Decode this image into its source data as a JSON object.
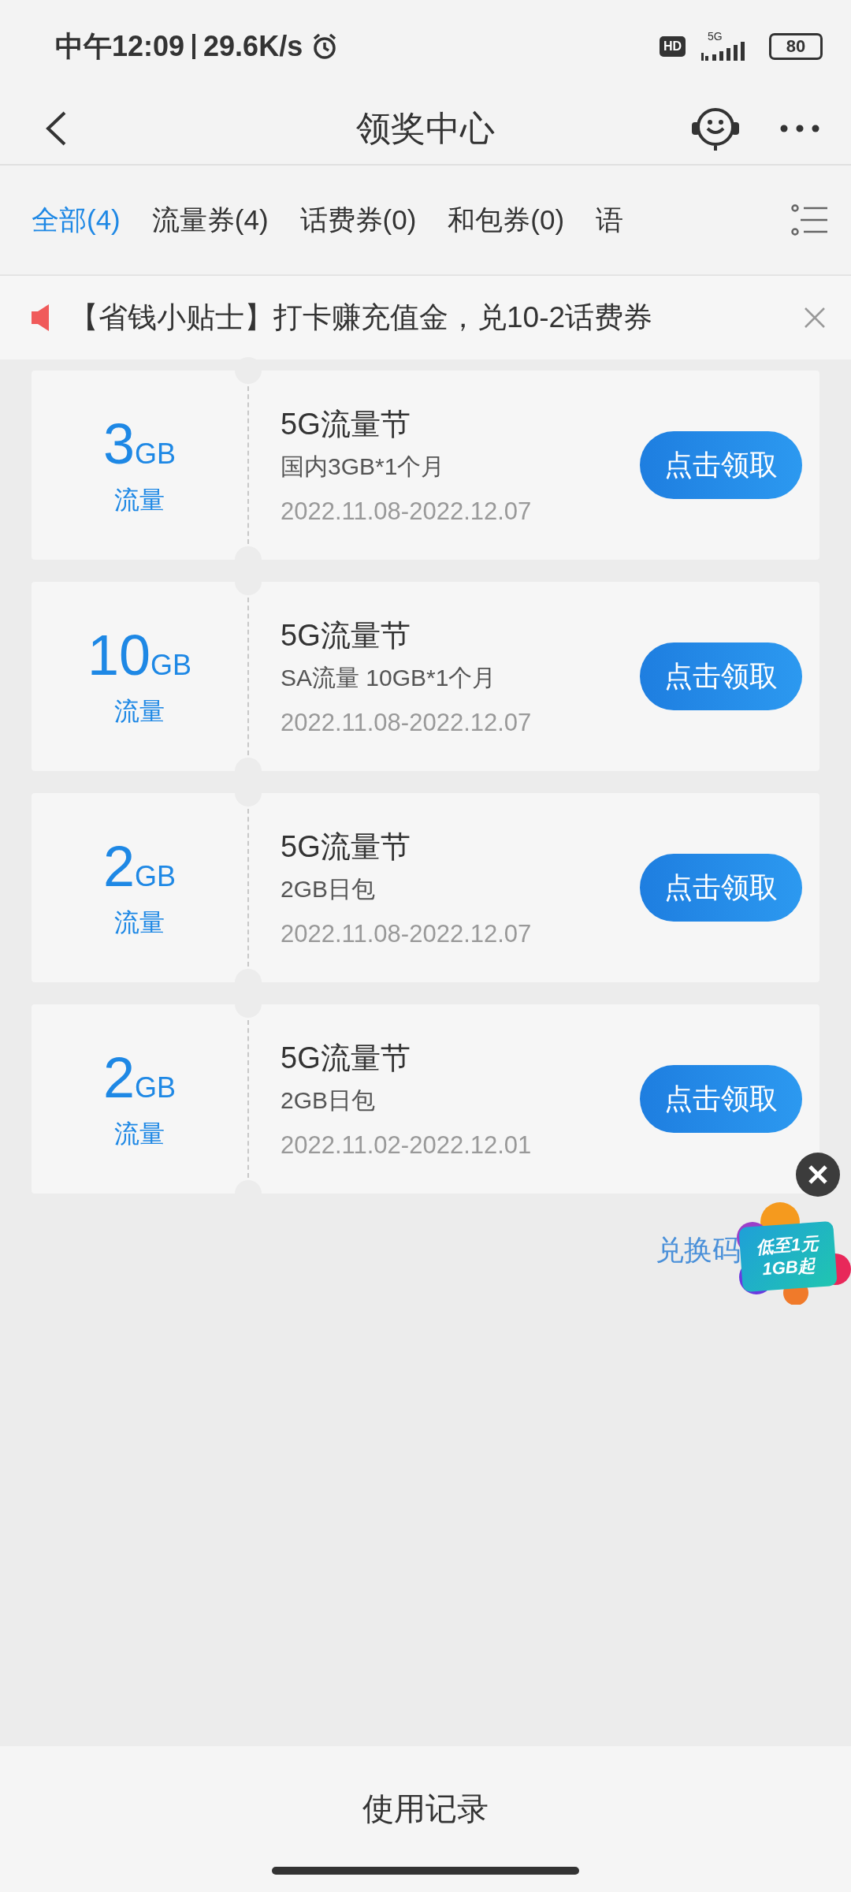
{
  "status_bar": {
    "time": "中午12:09",
    "speed": "29.6K/s",
    "hd": "HD",
    "network": "5G",
    "battery": "80"
  },
  "header": {
    "title": "领奖中心"
  },
  "tabs": [
    {
      "label": "全部(4)",
      "selected": true
    },
    {
      "label": "流量券(4)",
      "selected": false
    },
    {
      "label": "话费券(0)",
      "selected": false
    },
    {
      "label": "和包券(0)",
      "selected": false
    },
    {
      "label": "语",
      "selected": false
    }
  ],
  "tip": {
    "text": "【省钱小贴士】打卡赚充值金，兑10-2话费券"
  },
  "coupons": [
    {
      "amount": "3",
      "unit": "GB",
      "type": "流量",
      "title": "5G流量节",
      "desc": "国内3GB*1个月",
      "period": "2022.11.08-2022.12.07",
      "button": "点击领取"
    },
    {
      "amount": "10",
      "unit": "GB",
      "type": "流量",
      "title": "5G流量节",
      "desc": "SA流量 10GB*1个月",
      "period": "2022.11.08-2022.12.07",
      "button": "点击领取"
    },
    {
      "amount": "2",
      "unit": "GB",
      "type": "流量",
      "title": "5G流量节",
      "desc": "2GB日包",
      "period": "2022.11.08-2022.12.07",
      "button": "点击领取"
    },
    {
      "amount": "2",
      "unit": "GB",
      "type": "流量",
      "title": "5G流量节",
      "desc": "2GB日包",
      "period": "2022.11.02-2022.12.01",
      "button": "点击领取"
    }
  ],
  "redeem_link": "兑换码",
  "float_ad": {
    "lines": [
      "低至1元",
      "1GB起"
    ]
  },
  "bottom": {
    "label": "使用记录"
  }
}
